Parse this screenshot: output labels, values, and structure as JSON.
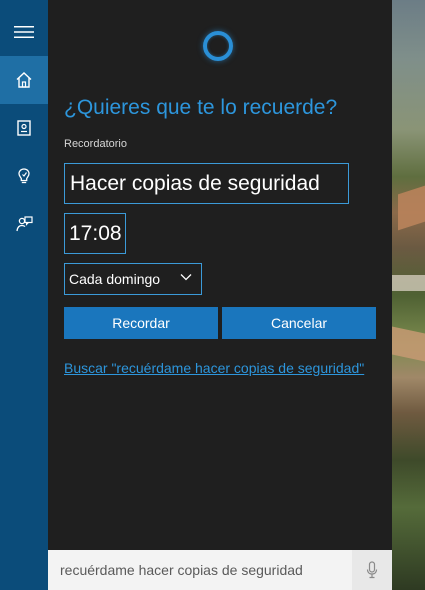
{
  "colors": {
    "rail": "#0b4c7a",
    "rail_active": "#1f6fa5",
    "panel": "#1f1f1f",
    "accent": "#2d96dc",
    "button": "#1a76bd",
    "search_bg": "#f3f3f3"
  },
  "rail": {
    "items": [
      {
        "icon": "hamburger-menu-icon",
        "active": false
      },
      {
        "icon": "home-icon",
        "active": true
      },
      {
        "icon": "notebook-icon",
        "active": false
      },
      {
        "icon": "lightbulb-reminders-icon",
        "active": false
      },
      {
        "icon": "feedback-icon",
        "active": false
      }
    ]
  },
  "reminder": {
    "question": "¿Quieres que te lo recuerde?",
    "label": "Recordatorio",
    "text": "Hacer copias de seguridad",
    "time": "17:08",
    "recurrence": "Cada domingo",
    "remind_button": "Recordar",
    "cancel_button": "Cancelar",
    "search_link": "Buscar \"recuérdame hacer copias de seguridad\""
  },
  "searchbar": {
    "query": "recuérdame hacer copias de seguridad",
    "mic_icon": "microphone-icon"
  }
}
